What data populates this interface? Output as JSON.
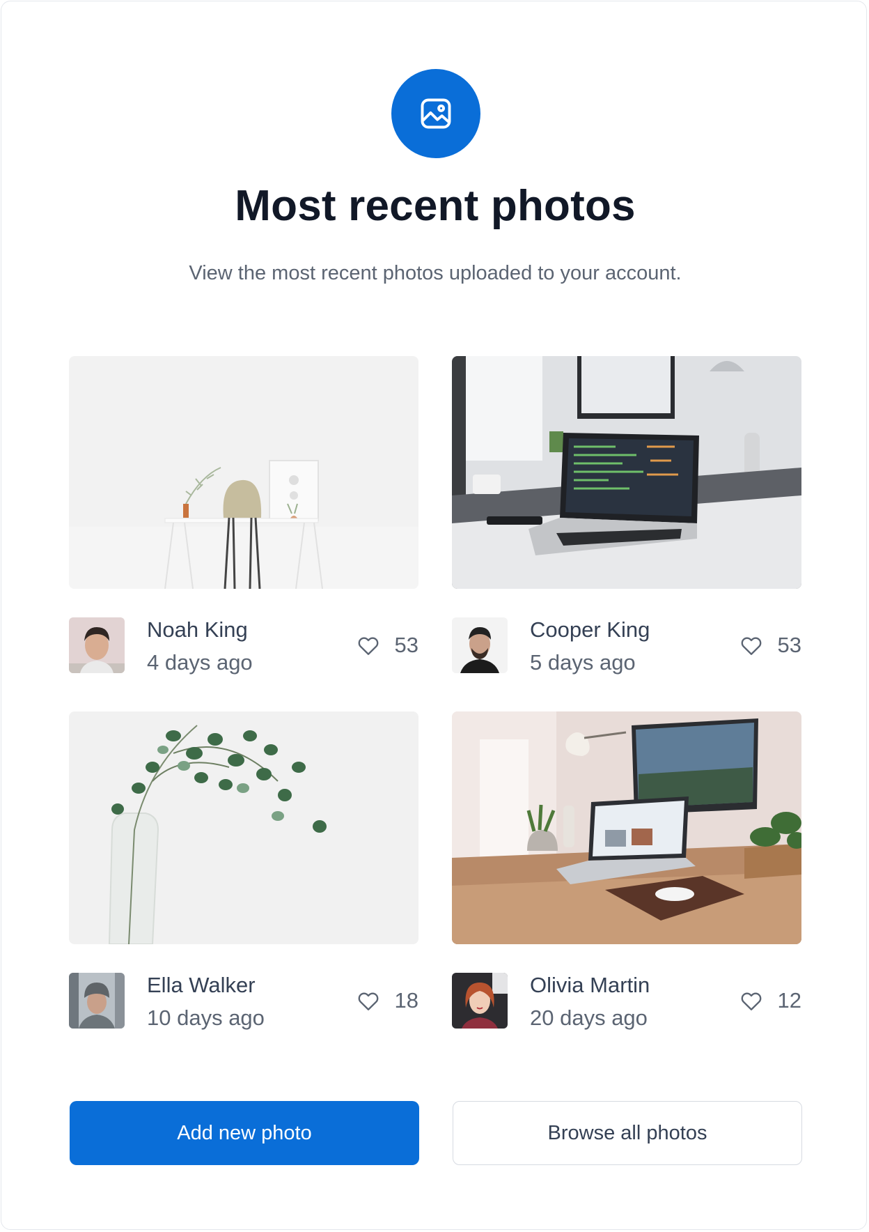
{
  "header": {
    "icon": "image-icon",
    "title": "Most recent photos",
    "subtitle": "View the most recent photos uploaded to your account."
  },
  "photos": [
    {
      "author": "Noah King",
      "time": "4 days ago",
      "likes": "53",
      "scene": "minimal white desk with chair and plant"
    },
    {
      "author": "Cooper King",
      "time": "5 days ago",
      "likes": "53",
      "scene": "laptop with code on desk in front of monitor"
    },
    {
      "author": "Ella Walker",
      "time": "10 days ago",
      "likes": "18",
      "scene": "eucalyptus branch in glass vase"
    },
    {
      "author": "Olivia Martin",
      "time": "20 days ago",
      "likes": "12",
      "scene": "wooden desk with laptop, monitor, lamp and plants"
    }
  ],
  "actions": {
    "primary_label": "Add new photo",
    "secondary_label": "Browse all photos"
  },
  "colors": {
    "accent": "#0a6ed8",
    "title": "#111827",
    "muted": "#5b6472"
  }
}
